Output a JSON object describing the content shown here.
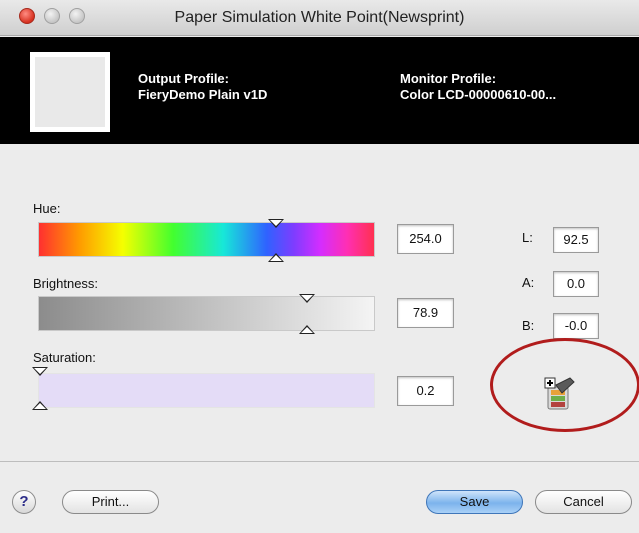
{
  "window": {
    "title": "Paper Simulation White Point(Newsprint)"
  },
  "header": {
    "output_label": "Output Profile:",
    "output_value": "FieryDemo Plain v1D",
    "monitor_label": "Monitor Profile:",
    "monitor_value": "Color LCD-00000610-00..."
  },
  "sliders": {
    "hue": {
      "label": "Hue:",
      "value": "254.0",
      "position_fraction": 0.7
    },
    "brightness": {
      "label": "Brightness:",
      "value": "78.9",
      "position_fraction": 0.79
    },
    "saturation": {
      "label": "Saturation:",
      "value": "0.2",
      "position_fraction": 0.0
    }
  },
  "lab": {
    "L": {
      "label": "L:",
      "value": "92.5"
    },
    "A": {
      "label": "A:",
      "value": "0.0"
    },
    "B": {
      "label": "B:",
      "value": "-0.0"
    }
  },
  "icons": {
    "tool": "color-picker-tool-icon",
    "help": "help-icon"
  },
  "buttons": {
    "help": "?",
    "print": "Print...",
    "save": "Save",
    "cancel": "Cancel"
  },
  "colors": {
    "highlight_ellipse": "#b11c1c",
    "default_button": "#7cb3ec",
    "swatch": "#e9e9e9"
  }
}
